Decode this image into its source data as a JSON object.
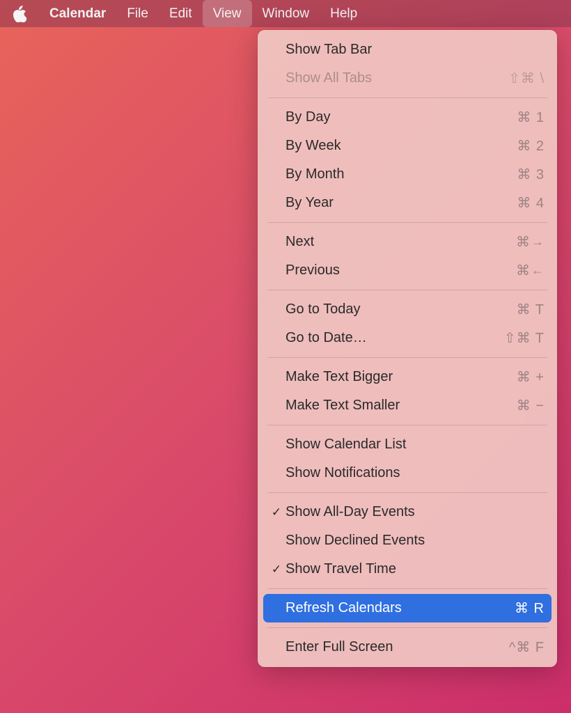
{
  "menubar": {
    "app_name": "Calendar",
    "items": [
      "File",
      "Edit",
      "View",
      "Window",
      "Help"
    ],
    "active_index": 2
  },
  "dropdown": {
    "groups": [
      [
        {
          "label": "Show Tab Bar",
          "shortcut": "",
          "checked": false,
          "disabled": false
        },
        {
          "label": "Show All Tabs",
          "shortcut": "⇧⌘ \\",
          "checked": false,
          "disabled": true
        }
      ],
      [
        {
          "label": "By Day",
          "shortcut": "⌘ 1",
          "checked": false,
          "disabled": false
        },
        {
          "label": "By Week",
          "shortcut": "⌘ 2",
          "checked": false,
          "disabled": false
        },
        {
          "label": "By Month",
          "shortcut": "⌘ 3",
          "checked": false,
          "disabled": false
        },
        {
          "label": "By Year",
          "shortcut": "⌘ 4",
          "checked": false,
          "disabled": false
        }
      ],
      [
        {
          "label": "Next",
          "shortcut": "⌘→",
          "checked": false,
          "disabled": false,
          "arrow": "right"
        },
        {
          "label": "Previous",
          "shortcut": "⌘←",
          "checked": false,
          "disabled": false,
          "arrow": "left"
        }
      ],
      [
        {
          "label": "Go to Today",
          "shortcut": "⌘ T",
          "checked": false,
          "disabled": false
        },
        {
          "label": "Go to Date…",
          "shortcut": "⇧⌘ T",
          "checked": false,
          "disabled": false
        }
      ],
      [
        {
          "label": "Make Text Bigger",
          "shortcut": "⌘ +",
          "checked": false,
          "disabled": false
        },
        {
          "label": "Make Text Smaller",
          "shortcut": "⌘ −",
          "checked": false,
          "disabled": false
        }
      ],
      [
        {
          "label": "Show Calendar List",
          "shortcut": "",
          "checked": false,
          "disabled": false
        },
        {
          "label": "Show Notifications",
          "shortcut": "",
          "checked": false,
          "disabled": false
        }
      ],
      [
        {
          "label": "Show All-Day Events",
          "shortcut": "",
          "checked": true,
          "disabled": false
        },
        {
          "label": "Show Declined Events",
          "shortcut": "",
          "checked": false,
          "disabled": false
        },
        {
          "label": "Show Travel Time",
          "shortcut": "",
          "checked": true,
          "disabled": false
        }
      ],
      [
        {
          "label": "Refresh Calendars",
          "shortcut": "⌘ R",
          "checked": false,
          "disabled": false,
          "highlighted": true
        }
      ],
      [
        {
          "label": "Enter Full Screen",
          "shortcut": "^⌘ F",
          "checked": false,
          "disabled": false
        }
      ]
    ]
  }
}
